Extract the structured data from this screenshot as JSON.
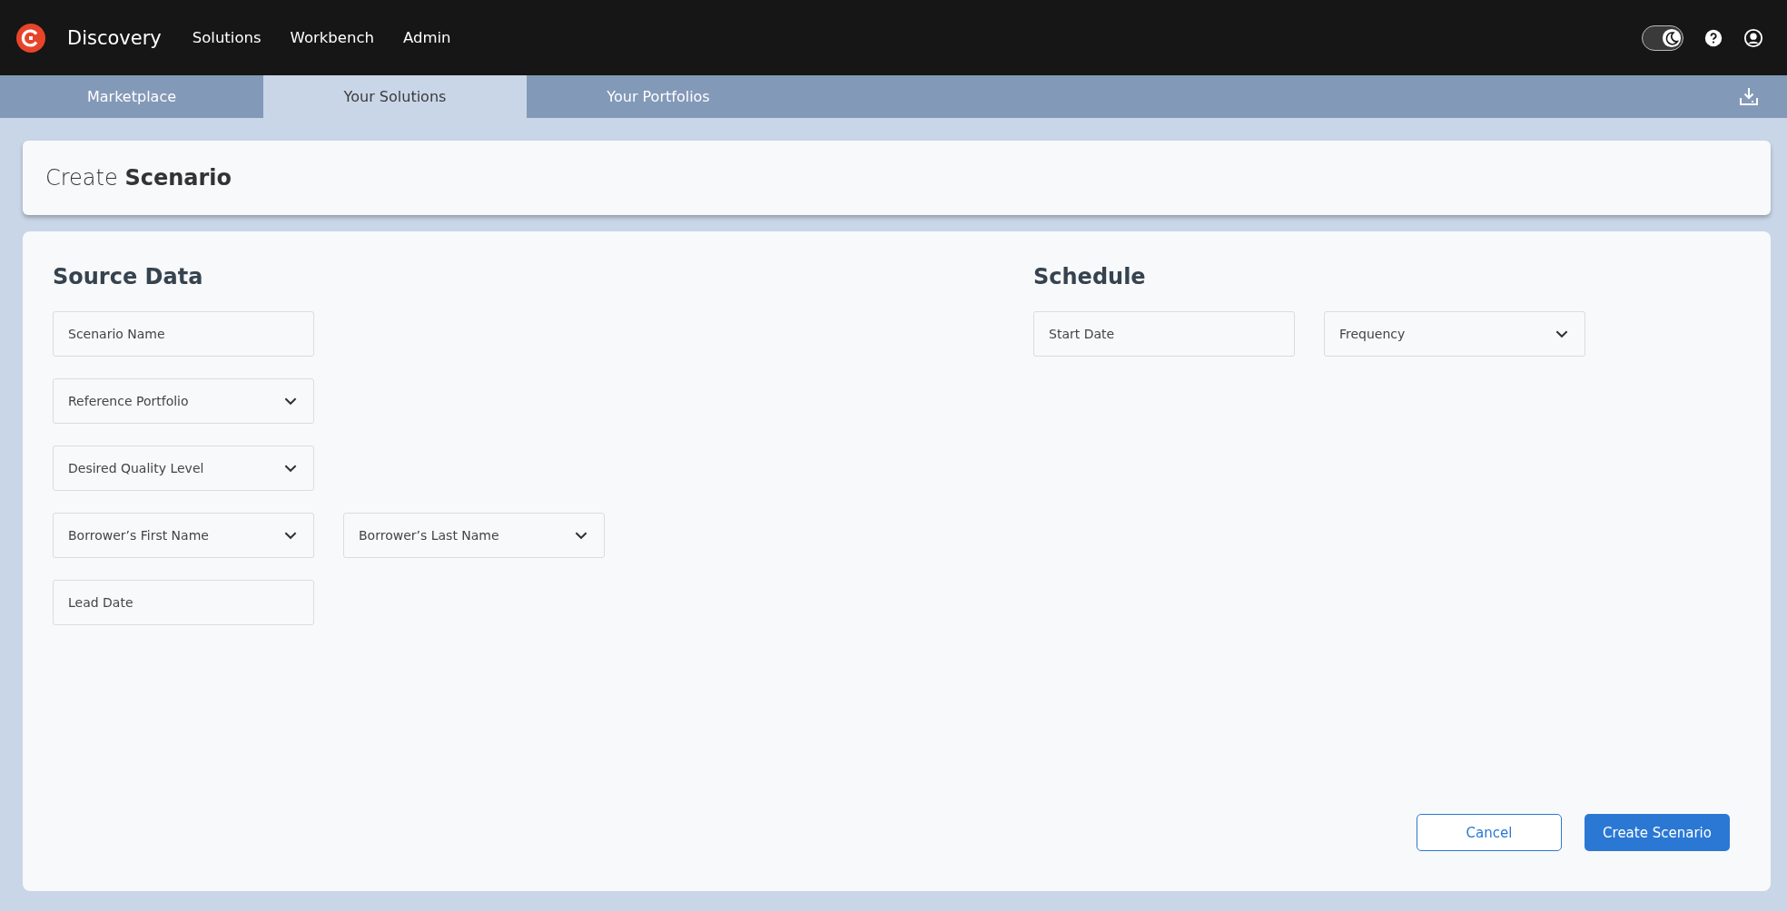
{
  "header": {
    "brand": "Discovery",
    "nav": [
      {
        "label": "Solutions"
      },
      {
        "label": "Workbench"
      },
      {
        "label": "Admin"
      }
    ],
    "theme_toggle": {
      "on": true
    }
  },
  "tabs": [
    {
      "label": "Marketplace",
      "selected": false
    },
    {
      "label": "Your Solutions",
      "selected": true
    },
    {
      "label": "Your Portfolios",
      "selected": false
    }
  ],
  "page_title": "Create **Scenario**",
  "source_data": {
    "heading": "Source Data",
    "rows": [
      [
        {
          "kind": "text",
          "placeholder": "Scenario Name"
        }
      ],
      [
        {
          "kind": "select",
          "placeholder": "Reference Portfolio"
        }
      ],
      [
        {
          "kind": "select",
          "placeholder": "Desired Quality Level"
        }
      ],
      [
        {
          "kind": "select",
          "placeholder": "Borrower’s First Name"
        },
        {
          "kind": "select",
          "placeholder": "Borrower’s Last Name"
        }
      ],
      [
        {
          "kind": "text",
          "placeholder": "Lead Date"
        }
      ]
    ]
  },
  "schedule": {
    "heading": "Schedule",
    "fields": [
      {
        "kind": "text",
        "placeholder": "Start Date"
      },
      {
        "kind": "select",
        "placeholder": "Frequency"
      }
    ]
  },
  "buttons": [
    {
      "kind": "secondary",
      "label": "Cancel"
    },
    {
      "kind": "primary",
      "label": "Create Scenario"
    }
  ]
}
